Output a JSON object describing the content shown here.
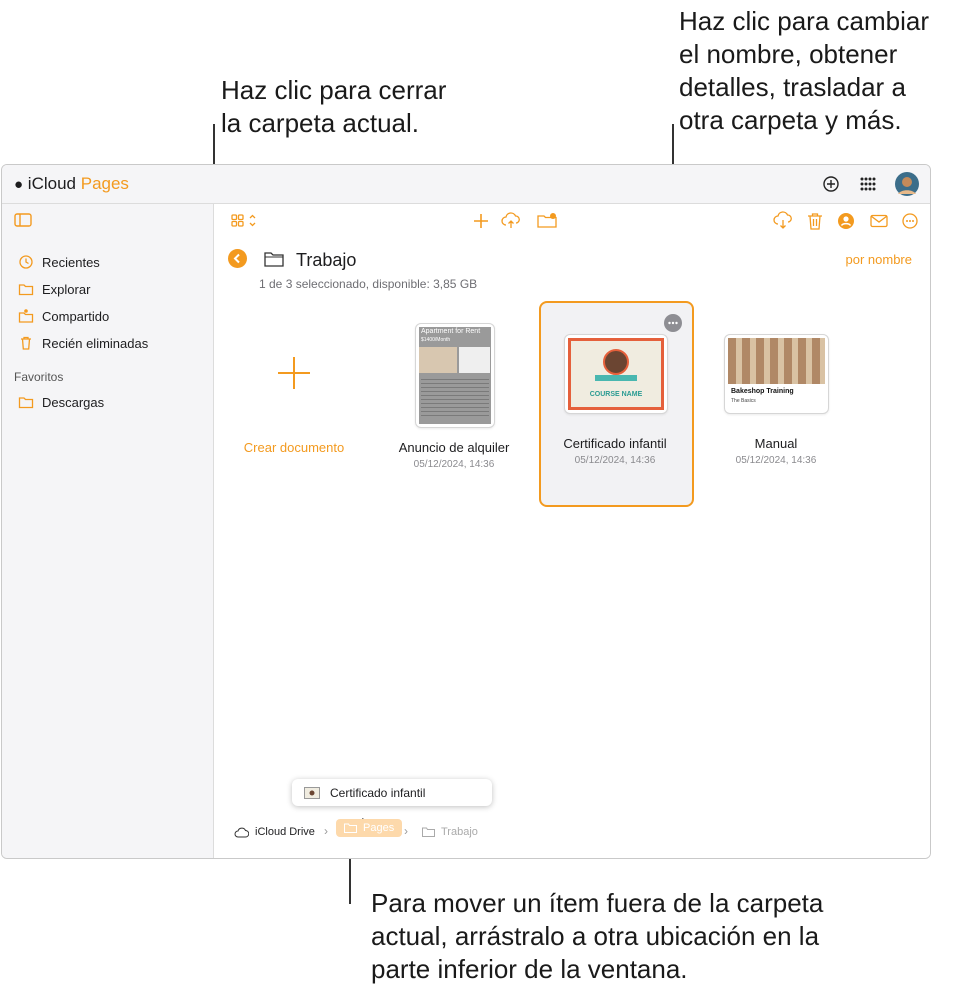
{
  "callouts": {
    "close_folder": "Haz clic para cerrar\nla carpeta actual.",
    "more_options": "Haz clic para cambiar\nel nombre, obtener\ndetalles, trasladar a\notra carpeta y más.",
    "move_item": "Para mover un ítem fuera de la carpeta\nactual, arrástralo a otra ubicación en la\nparte inferior de la ventana."
  },
  "app": {
    "brand_icloud": "iCloud",
    "brand_pages": "Pages"
  },
  "sidebar": {
    "items": [
      {
        "label": "Recientes",
        "icon": "clock-icon"
      },
      {
        "label": "Explorar",
        "icon": "folder-icon"
      },
      {
        "label": "Compartido",
        "icon": "shared-folder-icon"
      },
      {
        "label": "Recién eliminadas",
        "icon": "trash-icon"
      }
    ],
    "favorites_header": "Favoritos",
    "favorites": [
      {
        "label": "Descargas",
        "icon": "folder-icon"
      }
    ]
  },
  "folder": {
    "title": "Trabajo",
    "subtitle": "1 de 3 seleccionado, disponible: 3,85 GB",
    "sort_label": "por nombre"
  },
  "documents": [
    {
      "name": "Crear documento",
      "date": ""
    },
    {
      "name": "Anuncio de alquiler",
      "date": "05/12/2024, 14:36",
      "thumb_title": "Apartment for Rent",
      "thumb_sub": "$1400/Month"
    },
    {
      "name": "Certificado infantil",
      "date": "05/12/2024, 14:36",
      "thumb_title": "COURSE NAME",
      "selected": true
    },
    {
      "name": "Manual",
      "date": "05/12/2024, 14:36",
      "thumb_title": "Bakeshop Training",
      "thumb_sub": "The Basics"
    }
  ],
  "drag_item": "Certificado infantil",
  "breadcrumbs": [
    "iCloud Drive",
    "Pages",
    "Trabajo"
  ],
  "colors": {
    "accent": "#f39a1f"
  }
}
